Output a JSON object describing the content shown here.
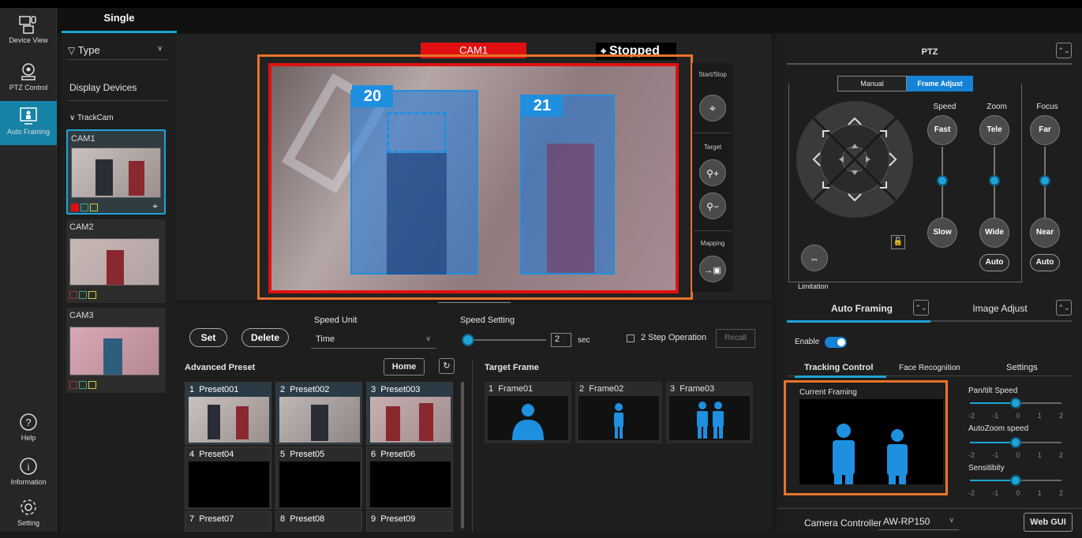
{
  "nav": {
    "items": [
      {
        "label": "Device View"
      },
      {
        "label": "PTZ Control"
      },
      {
        "label": "Auto Framing"
      },
      {
        "label": "Help"
      },
      {
        "label": "Information"
      },
      {
        "label": "Setting"
      }
    ]
  },
  "tab": {
    "label": "Single"
  },
  "devices": {
    "filter_label": "Type",
    "display_devices": "Display Devices",
    "group": "TrackCam",
    "cams": [
      {
        "label": "CAM1"
      },
      {
        "label": "CAM2"
      },
      {
        "label": "CAM3"
      }
    ]
  },
  "view": {
    "cam_label": "CAM1",
    "status": "Stopped",
    "targets": [
      {
        "id": "20"
      },
      {
        "id": "21"
      }
    ],
    "start_stop_label": "Start/Stop",
    "target_label": "Target",
    "mapping_label": "Mapping"
  },
  "preset": {
    "set_label": "Set",
    "delete_label": "Delete",
    "speed_unit_label": "Speed Unit",
    "speed_unit_value": "Time",
    "speed_setting_label": "Speed Setting",
    "speed_value": "2",
    "speed_unit_sec": "sec",
    "two_step_label": "2 Step Operation",
    "recall_label": "Recall",
    "advanced_title": "Advanced Preset",
    "home_label": "Home",
    "items": [
      {
        "num": "1",
        "name": "Preset001"
      },
      {
        "num": "2",
        "name": "Preset002"
      },
      {
        "num": "3",
        "name": "Preset003"
      },
      {
        "num": "4",
        "name": "Preset04"
      },
      {
        "num": "5",
        "name": "Preset05"
      },
      {
        "num": "6",
        "name": "Preset06"
      },
      {
        "num": "7",
        "name": "Preset07"
      },
      {
        "num": "8",
        "name": "Preset08"
      },
      {
        "num": "9",
        "name": "Preset09"
      }
    ]
  },
  "target_frame": {
    "title": "Target Frame",
    "items": [
      {
        "num": "1",
        "name": "Frame01"
      },
      {
        "num": "2",
        "name": "Frame02"
      },
      {
        "num": "3",
        "name": "Frame03"
      }
    ]
  },
  "ptz": {
    "title": "PTZ",
    "mode_manual": "Manual",
    "mode_frame": "Frame Adjust",
    "speed_label": "Speed",
    "zoom_label": "Zoom",
    "focus_label": "Focus",
    "fast": "Fast",
    "slow": "Slow",
    "tele": "Tele",
    "wide": "Wide",
    "far": "Far",
    "near": "Near",
    "auto": "Auto",
    "limitation": "Limitation"
  },
  "af": {
    "tab_auto": "Auto Framing",
    "tab_image": "Image Adjust",
    "enable": "Enable",
    "sub_tracking": "Tracking Control",
    "sub_face": "Face Recognition",
    "sub_settings": "Settings",
    "current_framing": "Current Framing",
    "pantilt": "Pan/tilt Speed",
    "autozoom": "AutoZoom speed",
    "sensitivity": "Sensitibity",
    "ticks": [
      "-2",
      "-1",
      "0",
      "1",
      "2"
    ]
  },
  "footer": {
    "controller_label": "Camera Controller",
    "controller_value": "AW-RP150",
    "webgui": "Web GUI"
  },
  "colors": {
    "accent": "#1fa3d6",
    "highlight": "#e8742a",
    "rec": "#e01010"
  }
}
